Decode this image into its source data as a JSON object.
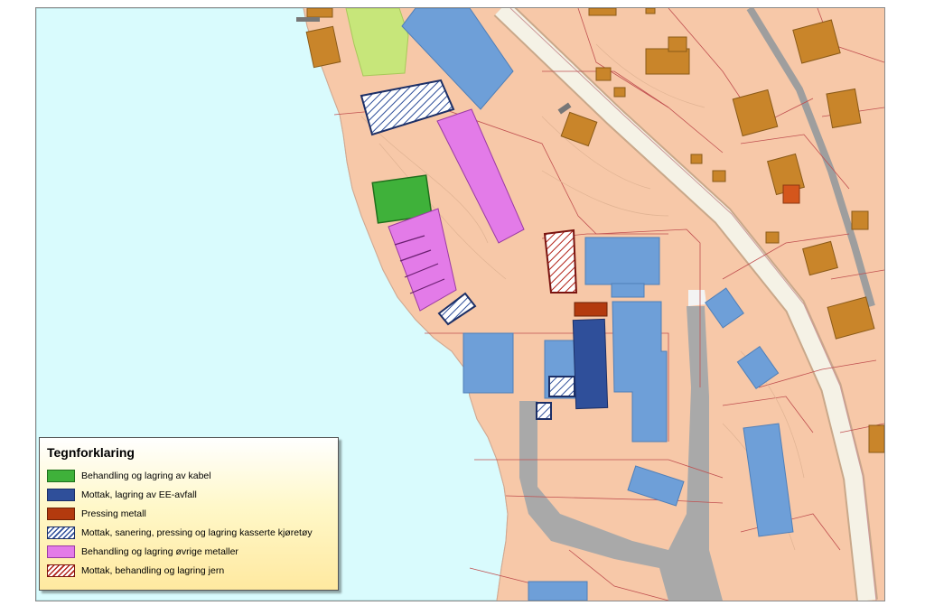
{
  "legend": {
    "title": "Tegnforklaring",
    "items": [
      {
        "label": "Behandling og lagring av kabel",
        "fill": "#3fb13a",
        "stroke": "#1f6f1c",
        "pattern": "solid"
      },
      {
        "label": "Mottak, lagring av EE-avfall",
        "fill": "#2f4f9a",
        "stroke": "#1c2f66",
        "pattern": "solid"
      },
      {
        "label": "Pressing metall",
        "fill": "#b33a0e",
        "stroke": "#6e2206",
        "pattern": "solid"
      },
      {
        "label": "Mottak, sanering, pressing og lagring kasserte kjøretøy",
        "fill": "#2f4f9a",
        "stroke": "#1c2f66",
        "pattern": "hatch"
      },
      {
        "label": "Behandling og lagring øvrige metaller",
        "fill": "#e37be8",
        "stroke": "#9a3aa3",
        "pattern": "solid"
      },
      {
        "label": "Mottak, behandling og lagring jern",
        "fill": "#b3241a",
        "stroke": "#7a1410",
        "pattern": "hatch"
      }
    ]
  },
  "colors": {
    "water": "#d9fbfd",
    "land": "#f7c8a8",
    "building": "#6e9fd8",
    "house": "#c9852a",
    "road": "#f5f2e6",
    "asphalt": "#a9a9a9",
    "green_area": "#c7e67a"
  }
}
